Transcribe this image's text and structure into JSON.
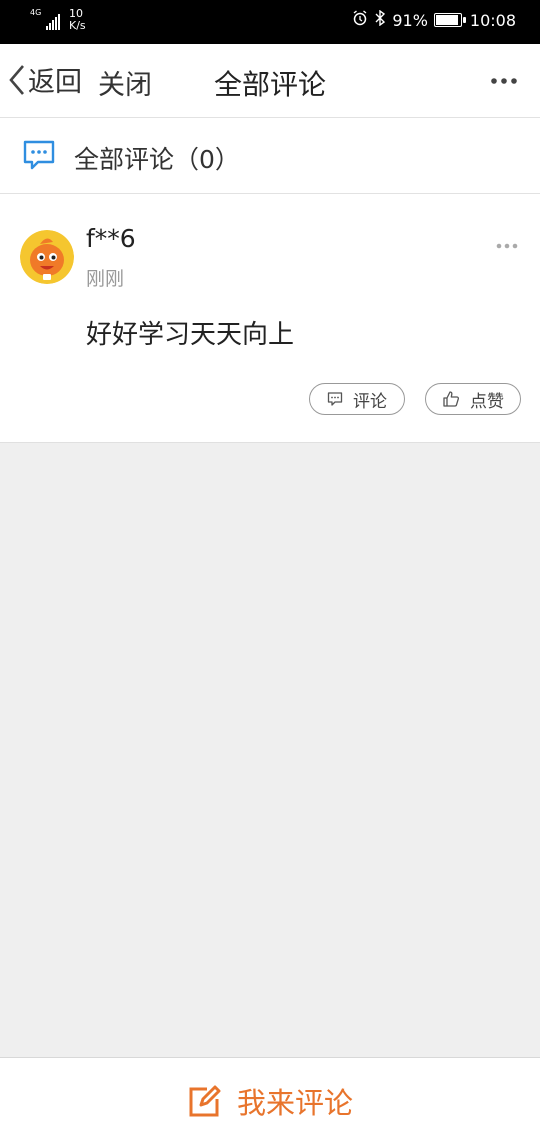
{
  "status_bar": {
    "network": "4G",
    "speed_value": "10",
    "speed_unit": "K/s",
    "battery_percent": "91%",
    "battery_level": 0.91,
    "time": "10:08"
  },
  "nav": {
    "back_label": "返回",
    "close_label": "关闭",
    "title": "全部评论"
  },
  "section": {
    "title": "全部评论（0）"
  },
  "comment": {
    "username": "f**6",
    "timestamp": "刚刚",
    "body": "好好学习天天向上",
    "comment_button_label": "评论",
    "like_button_label": "点赞"
  },
  "bottom_bar": {
    "write_label": "我来评论"
  },
  "colors": {
    "accent": "#e8742c",
    "section_icon": "#2f8ee0",
    "background": "#efefef"
  }
}
